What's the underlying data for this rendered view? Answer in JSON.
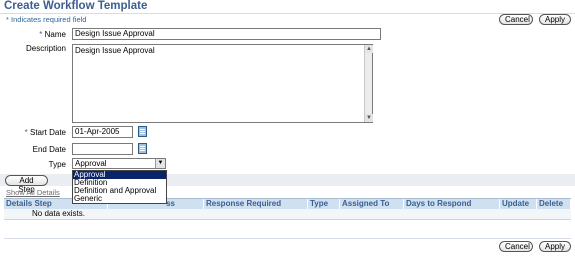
{
  "page": {
    "title": "Create Workflow Template",
    "required_note": "Indicates required field",
    "required_marker": "*"
  },
  "buttons": {
    "cancel": "Cancel",
    "apply": "Apply",
    "add_step": "Add Step"
  },
  "form": {
    "name_label": "Name",
    "name_value": "Design Issue Approval",
    "description_label": "Description",
    "description_value": "Design Issue Approval",
    "start_date_label": "Start Date",
    "start_date_value": "01-Apr-2005",
    "end_date_label": "End Date",
    "end_date_value": "",
    "type_label": "Type",
    "type_value": "Approval",
    "type_options": [
      "Approval",
      "Definition",
      "Definition and Approval",
      "Generic"
    ]
  },
  "steps_table": {
    "show_all_details": "Show All Details",
    "columns": [
      "Details Step",
      "ss",
      "Response Required",
      "Type",
      "Assigned To",
      "Days to Respond",
      "Update",
      "Delete"
    ],
    "empty_message": "No data exists."
  },
  "icons": {
    "calendar": "calendar-icon",
    "dropdown": "chevron-down-icon"
  },
  "colors": {
    "header_text": "#3c5e8e",
    "table_header_bg": "#cfe0f1",
    "selected_option_bg": "#0a246a"
  }
}
